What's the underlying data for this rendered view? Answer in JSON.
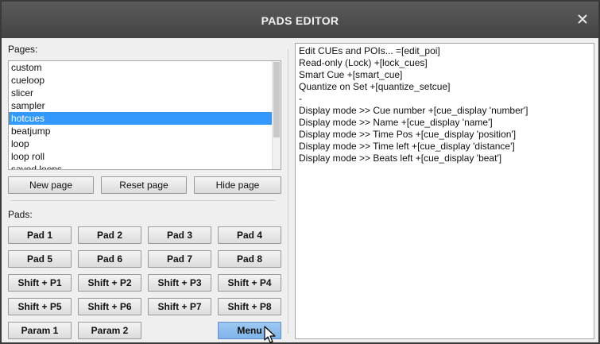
{
  "window": {
    "title": "PADS EDITOR"
  },
  "pages": {
    "label": "Pages:",
    "items": [
      "custom",
      "cueloop",
      "slicer",
      "sampler",
      "hotcues",
      "beatjump",
      "loop",
      "loop roll",
      "saved loops"
    ],
    "selected": "hotcues"
  },
  "page_buttons": {
    "new": "New page",
    "reset": "Reset page",
    "hide": "Hide page"
  },
  "pads": {
    "label": "Pads:",
    "row1": [
      "Pad 1",
      "Pad 2",
      "Pad 3",
      "Pad 4"
    ],
    "row2": [
      "Pad 5",
      "Pad 6",
      "Pad 7",
      "Pad 8"
    ],
    "row3": [
      "Shift + P1",
      "Shift + P2",
      "Shift + P3",
      "Shift + P4"
    ],
    "row4": [
      "Shift + P5",
      "Shift + P6",
      "Shift + P7",
      "Shift + P8"
    ],
    "row5": [
      "Param 1",
      "Param 2",
      "Menu"
    ],
    "active": "Menu"
  },
  "editor": {
    "lines": [
      "Edit CUEs and POIs... =[edit_poi]",
      "Read-only (Lock) +[lock_cues]",
      "Smart Cue +[smart_cue]",
      "Quantize on Set +[quantize_setcue]",
      "-",
      "Display mode >> Cue number +[cue_display 'number']",
      "Display mode >> Name +[cue_display 'name']",
      "Display mode >> Time Pos +[cue_display 'position']",
      "Display mode >> Time left +[cue_display 'distance']",
      "Display mode >> Beats left +[cue_display 'beat']"
    ]
  },
  "colors": {
    "titlebar": "#4a4a4a",
    "selection": "#3399ff",
    "active_pad": "#8cbdf0"
  }
}
